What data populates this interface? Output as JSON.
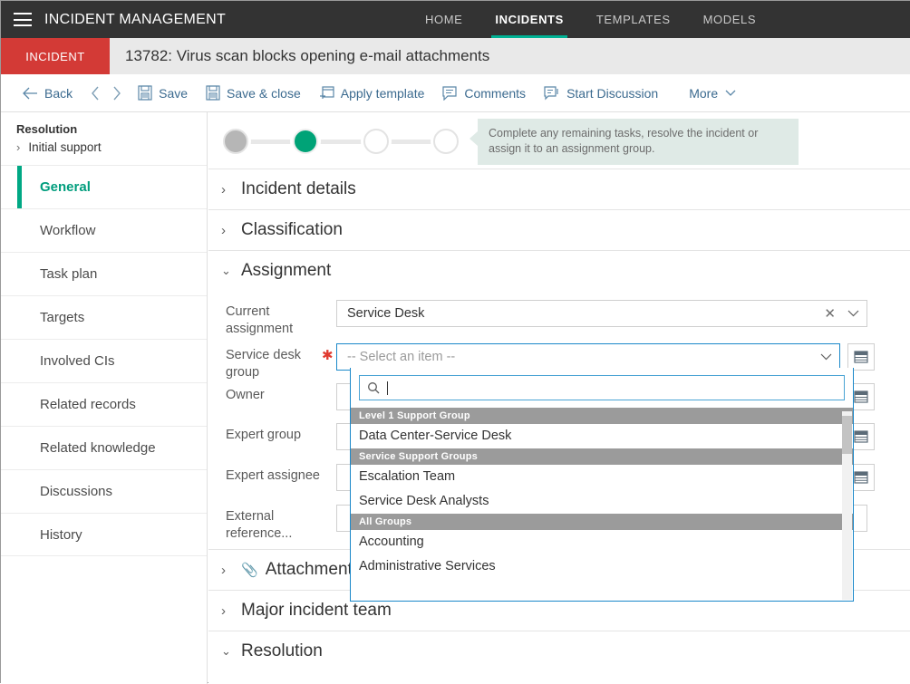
{
  "topbar": {
    "menu_icon": "hamburger-icon",
    "app_title": "INCIDENT MANAGEMENT",
    "nav": [
      {
        "label": "HOME",
        "active": false
      },
      {
        "label": "INCIDENTS",
        "active": true
      },
      {
        "label": "TEMPLATES",
        "active": false
      },
      {
        "label": "MODELS",
        "active": false
      }
    ],
    "accent_color": "#00b294",
    "background_color": "#333333"
  },
  "record_header": {
    "type_badge": "INCIDENT",
    "type_badge_color": "#d33a36",
    "title": "13782: Virus scan blocks opening e-mail attachments",
    "background_color": "#e9e9e9"
  },
  "toolbar": {
    "back_label": "Back",
    "prev_icon": "chevron-left-icon",
    "next_icon": "chevron-right-icon",
    "items": [
      {
        "label": "Save",
        "icon": "save-icon"
      },
      {
        "label": "Save & close",
        "icon": "save-close-icon"
      },
      {
        "label": "Apply template",
        "icon": "apply-template-icon"
      },
      {
        "label": "Comments",
        "icon": "comment-icon"
      },
      {
        "label": "Start Discussion",
        "icon": "discussion-icon"
      }
    ],
    "more_label": "More",
    "link_color": "#3b6a8f"
  },
  "sidebar": {
    "resolution_label": "Resolution",
    "initial_support_label": "Initial support",
    "items": [
      {
        "label": "General",
        "active": true
      },
      {
        "label": "Workflow",
        "active": false
      },
      {
        "label": "Task plan",
        "active": false
      },
      {
        "label": "Targets",
        "active": false
      },
      {
        "label": "Involved CIs",
        "active": false
      },
      {
        "label": "Related records",
        "active": false
      },
      {
        "label": "Related knowledge",
        "active": false
      },
      {
        "label": "Discussions",
        "active": false
      },
      {
        "label": "History",
        "active": false
      }
    ],
    "active_color": "#009d7d"
  },
  "progress": {
    "steps": [
      {
        "state": "done"
      },
      {
        "state": "current"
      },
      {
        "state": "empty"
      },
      {
        "state": "empty"
      }
    ],
    "callout_text": "Complete any remaining tasks, resolve the incident or assign it to an assignment group.",
    "callout_bg": "#dfeae6"
  },
  "sections": [
    {
      "title": "Incident details",
      "expanded": false,
      "icon": null
    },
    {
      "title": "Classification",
      "expanded": false,
      "icon": null
    },
    {
      "title": "Assignment",
      "expanded": true,
      "icon": null
    }
  ],
  "sections_bottom": [
    {
      "title": "Attachments",
      "expanded": false,
      "icon": "paperclip-icon"
    },
    {
      "title": "Major incident team",
      "expanded": false,
      "icon": null
    },
    {
      "title": "Resolution",
      "expanded": true,
      "icon": null
    }
  ],
  "assignment_form": {
    "fields": [
      {
        "label": "Current assignment",
        "required": false,
        "value": "Service Desk",
        "placeholder": "",
        "has_clear": true,
        "has_chevron": true,
        "has_lookup": false
      },
      {
        "label": "Service desk group",
        "required": true,
        "value": "",
        "placeholder": "-- Select an item --",
        "has_clear": false,
        "has_chevron": true,
        "has_lookup": true
      },
      {
        "label": "Owner",
        "required": false,
        "value": "",
        "placeholder": "",
        "has_clear": false,
        "has_chevron": false,
        "has_lookup": true
      },
      {
        "label": "Expert group",
        "required": false,
        "value": "",
        "placeholder": "",
        "has_clear": false,
        "has_chevron": false,
        "has_lookup": true
      },
      {
        "label": "Expert assignee",
        "required": false,
        "value": "",
        "placeholder": "",
        "has_clear": false,
        "has_chevron": false,
        "has_lookup": true
      },
      {
        "label": "External reference...",
        "required": false,
        "value": "",
        "placeholder": "",
        "has_clear": false,
        "has_chevron": false,
        "has_lookup": false
      }
    ]
  },
  "dropdown": {
    "open": true,
    "search_value": "",
    "search_icon": "search-icon",
    "groups": [
      {
        "header": "Level 1 Support Group",
        "options": [
          "Data Center-Service Desk"
        ]
      },
      {
        "header": "Service Support Groups",
        "options": [
          "Escalation Team",
          "Service Desk Analysts"
        ]
      },
      {
        "header": "All Groups",
        "options": [
          "Accounting",
          "Administrative Services"
        ]
      }
    ],
    "border_color": "#1a88c9",
    "group_header_bg": "#9b9b9b"
  }
}
